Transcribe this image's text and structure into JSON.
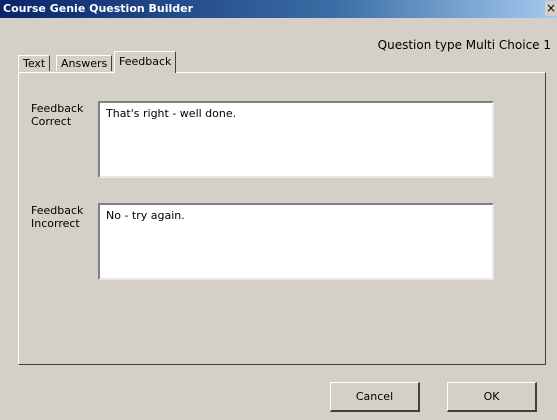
{
  "window": {
    "title": "Course Genie Question Builder",
    "close_glyph": "×"
  },
  "question_type": "Question type Multi Choice 1",
  "tabs": [
    {
      "label": "Text",
      "active": false
    },
    {
      "label": "Answers",
      "active": false
    },
    {
      "label": "Feedback",
      "active": true
    }
  ],
  "feedback": {
    "correct_label": "Feedback\nCorrect",
    "correct_value": "That's right - well done.",
    "incorrect_label": "Feedback\nIncorrect",
    "incorrect_value": "No - try again."
  },
  "buttons": {
    "cancel": "Cancel",
    "ok": "OK"
  }
}
